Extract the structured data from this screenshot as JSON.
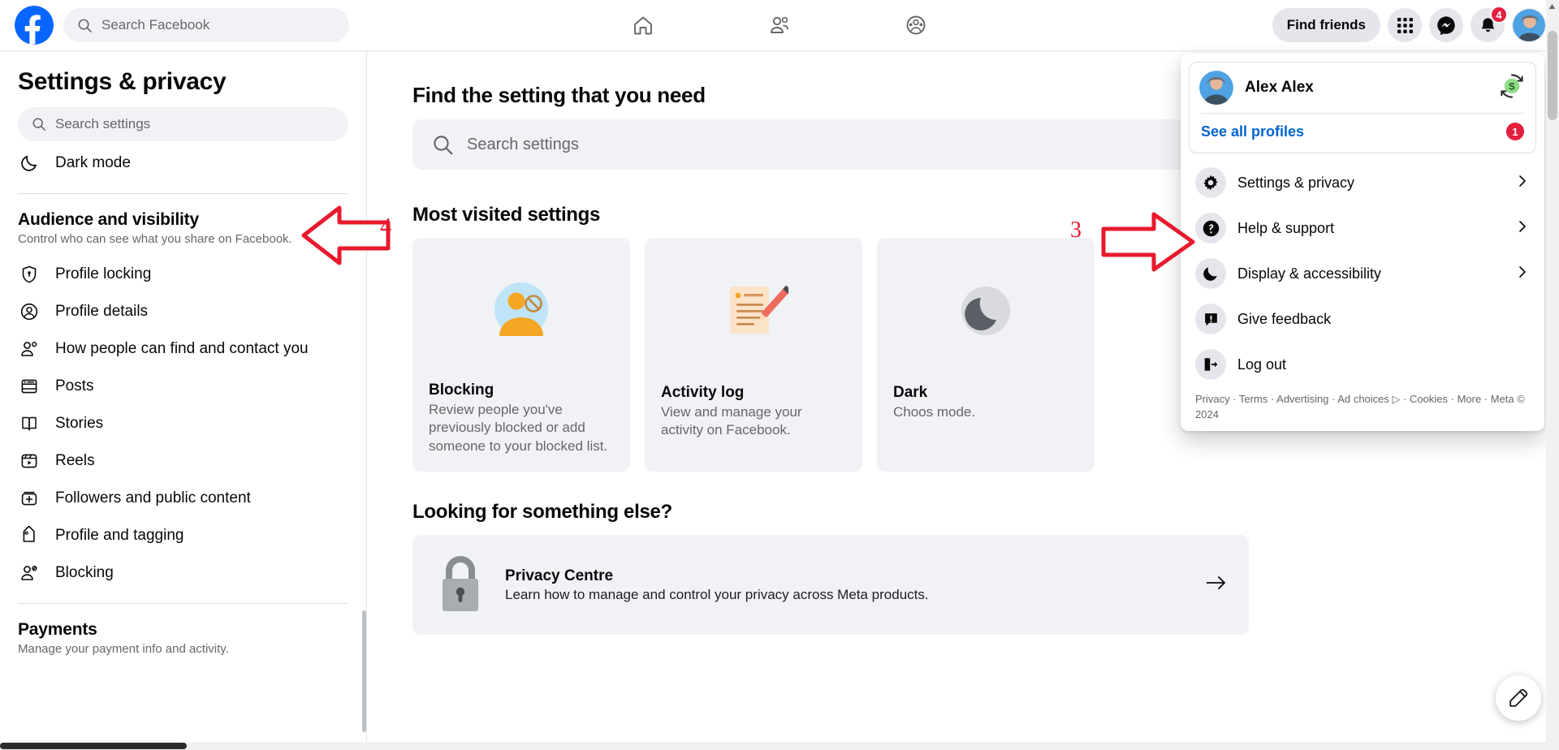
{
  "topbar": {
    "logo_icon": "facebook-logo",
    "search_placeholder": "Search Facebook",
    "search_icon": "search-icon",
    "nav": [
      {
        "icon": "home-icon",
        "name": "home"
      },
      {
        "icon": "friends-icon",
        "name": "friends"
      },
      {
        "icon": "groups-icon",
        "name": "groups"
      }
    ],
    "find_friends_label": "Find friends",
    "menu_grid_icon": "grid-menu-icon",
    "messenger_icon": "messenger-icon",
    "notifications_icon": "bell-icon",
    "notifications_count": "4",
    "avatar_icon": "user-avatar"
  },
  "sidebar": {
    "title": "Settings & privacy",
    "search_placeholder": "Search settings",
    "search_icon": "search-icon",
    "top_item": {
      "label": "Dark mode",
      "icon": "moon-icon"
    },
    "section": {
      "title": "Audience and visibility",
      "subtitle": "Control who can see what you share on Facebook."
    },
    "items": [
      {
        "label": "Profile locking",
        "icon": "shield-lock-icon"
      },
      {
        "label": "Profile details",
        "icon": "person-circle-icon"
      },
      {
        "label": "How people can find and contact you",
        "icon": "person-search-icon"
      },
      {
        "label": "Posts",
        "icon": "posts-icon"
      },
      {
        "label": "Stories",
        "icon": "stories-book-icon"
      },
      {
        "label": "Reels",
        "icon": "reels-icon"
      },
      {
        "label": "Followers and public content",
        "icon": "followers-plus-icon"
      },
      {
        "label": "Profile and tagging",
        "icon": "tag-icon"
      },
      {
        "label": "Blocking",
        "icon": "person-block-icon"
      }
    ],
    "payments": {
      "title": "Payments",
      "subtitle": "Manage your payment info and activity."
    }
  },
  "main": {
    "find_heading": "Find the setting that you need",
    "search_placeholder": "Search settings",
    "search_icon": "search-icon",
    "most_visited_heading": "Most visited settings",
    "cards": [
      {
        "title": "Blocking",
        "desc": "Review people you've previously blocked or add someone to your blocked list.",
        "art": "blocking-illustration"
      },
      {
        "title": "Activity log",
        "desc": "View and manage your activity on Facebook.",
        "art": "activity-log-illustration"
      },
      {
        "title": "Dark",
        "desc": "Choos mode.",
        "art": "dark-mode-illustration"
      }
    ],
    "looking_heading": "Looking for something else?",
    "privacy_centre": {
      "title": "Privacy Centre",
      "desc": "Learn how to manage and control your privacy across Meta products.",
      "icon": "padlock-icon",
      "arrow_icon": "arrow-right-icon"
    }
  },
  "dropdown": {
    "profile": {
      "name": "Alex Alex",
      "avatar_icon": "user-avatar",
      "status_badge_letter": "S",
      "status_badge_icon": "switch-profile-icon"
    },
    "see_all_profiles_label": "See all profiles",
    "see_all_profiles_badge": "1",
    "items": [
      {
        "label": "Settings & privacy",
        "icon": "gear-icon",
        "chevron": true
      },
      {
        "label": "Help & support",
        "icon": "question-circle-icon",
        "chevron": true
      },
      {
        "label": "Display & accessibility",
        "icon": "moon-icon",
        "chevron": true
      },
      {
        "label": "Give feedback",
        "icon": "feedback-icon",
        "chevron": false
      },
      {
        "label": "Log out",
        "icon": "logout-icon",
        "chevron": false
      }
    ],
    "footer": "Privacy · Terms · Advertising · Ad choices ▷ · Cookies · More · Meta © 2024"
  },
  "fab": {
    "icon": "compose-pencil-icon"
  },
  "annotations": [
    {
      "label": "3",
      "points": "right"
    },
    {
      "label": "4",
      "points": "left"
    }
  ],
  "colors": {
    "fb_blue": "#0866ff",
    "link_blue": "#0064d1",
    "badge_red": "#e41e3f",
    "annotation_red": "#e8192c",
    "surface_grey": "#f0f2f5",
    "text_secondary": "#65676b"
  }
}
